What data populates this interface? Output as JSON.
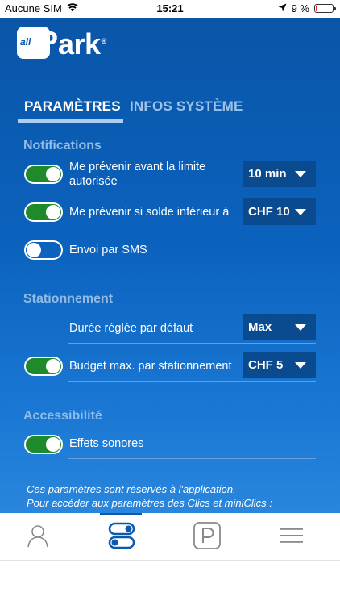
{
  "status_bar": {
    "carrier": "Aucune SIM",
    "time": "15:21",
    "battery_percent": "9 %",
    "battery_level": 0.09,
    "icons": [
      "wifi-icon",
      "location-arrow-icon",
      "battery-icon"
    ]
  },
  "app": {
    "logo_small": "all",
    "logo_text": "ark",
    "logo_p": "P",
    "logo_registered": "®"
  },
  "tabs": {
    "settings": "PARAMÈTRES",
    "system_info": "INFOS SYSTÈME",
    "active": "settings"
  },
  "notifications": {
    "title": "Notifications",
    "before_limit": {
      "label": "Me prévenir avant la limite autorisée",
      "enabled": true,
      "value": "10 min"
    },
    "low_balance": {
      "label": "Me prévenir si solde inférieur à",
      "enabled": true,
      "value": "CHF 10"
    },
    "sms": {
      "label": "Envoi par SMS",
      "enabled": false
    }
  },
  "parking": {
    "title": "Stationnement",
    "default_duration": {
      "label": "Durée réglée par défaut",
      "value": "Max"
    },
    "max_budget": {
      "label": "Budget max. par stationnement",
      "enabled": true,
      "value": "CHF 5"
    }
  },
  "accessibility": {
    "title": "Accessibilité",
    "sound_effects": {
      "label": "Effets sonores",
      "enabled": true
    }
  },
  "footnote": {
    "line1": "Ces paramètres sont réservés à l'application.",
    "line2": "Pour accéder aux paramètres des Clics et miniClics :"
  },
  "tab_bar": {
    "items": [
      "profile-icon",
      "settings-toggles-icon",
      "parking-icon",
      "menu-icon"
    ],
    "active": "settings-toggles-icon"
  },
  "colors": {
    "primary_blue": "#0b5ab0",
    "toggle_on": "#1f8a2b",
    "section_title": "#8fbbe6",
    "battery_low": "#e02020"
  }
}
